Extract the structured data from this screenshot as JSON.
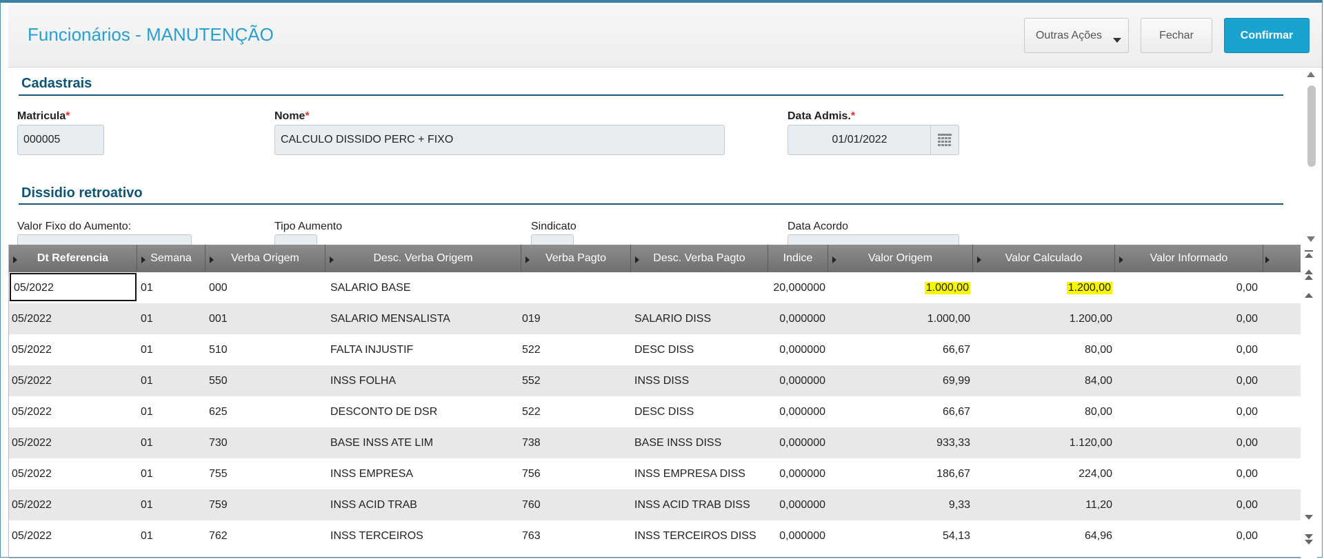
{
  "window": {
    "title": "Funcionários - MANUTENÇÃO"
  },
  "toolbar": {
    "more_actions_label": "Outras Ações",
    "close_label": "Fechar",
    "confirm_label": "Confirmar"
  },
  "sections": {
    "cadastrais": "Cadastrais",
    "dissidio": "Dissidio retroativo"
  },
  "form": {
    "matricula": {
      "label": "Matricula",
      "value": "000005"
    },
    "nome": {
      "label": "Nome",
      "value": "CALCULO DISSIDO PERC + FIXO"
    },
    "data_admis": {
      "label": "Data Admis.",
      "value": "01/01/2022"
    },
    "required_mark": "*",
    "valor_fixo_label": "Valor Fixo do Aumento:",
    "tipo_aumento_label": "Tipo Aumento",
    "sindicato_label": "Sindicato",
    "data_acordo_label": "Data Acordo"
  },
  "grid": {
    "columns": [
      "Dt Referencia",
      "Semana",
      "Verba Origem",
      "Desc. Verba Origem",
      "Verba Pagto",
      "Desc. Verba Pagto",
      "Indice",
      "Valor Origem",
      "Valor Calculado",
      "Valor Informado"
    ],
    "rows": [
      [
        "05/2022",
        "01",
        "000",
        "SALARIO BASE",
        "",
        "",
        "20,000000",
        "1.000,00",
        "1.200,00",
        "0,00"
      ],
      [
        "05/2022",
        "01",
        "001",
        "SALARIO MENSALISTA",
        "019",
        "SALARIO DISS",
        "0,000000",
        "1.000,00",
        "1.200,00",
        "0,00"
      ],
      [
        "05/2022",
        "01",
        "510",
        "FALTA INJUSTIF",
        "522",
        "DESC DISS",
        "0,000000",
        "66,67",
        "80,00",
        "0,00"
      ],
      [
        "05/2022",
        "01",
        "550",
        "INSS FOLHA",
        "552",
        "INSS DISS",
        "0,000000",
        "69,99",
        "84,00",
        "0,00"
      ],
      [
        "05/2022",
        "01",
        "625",
        "DESCONTO DE DSR",
        "522",
        "DESC DISS",
        "0,000000",
        "66,67",
        "80,00",
        "0,00"
      ],
      [
        "05/2022",
        "01",
        "730",
        "BASE INSS ATE LIM",
        "738",
        "BASE INSS DISS",
        "0,000000",
        "933,33",
        "1.120,00",
        "0,00"
      ],
      [
        "05/2022",
        "01",
        "755",
        "INSS EMPRESA",
        "756",
        "INSS EMPRESA DISS",
        "0,000000",
        "186,67",
        "224,00",
        "0,00"
      ],
      [
        "05/2022",
        "01",
        "759",
        "INSS ACID TRAB",
        "760",
        "INSS ACID TRAB DISS",
        "0,000000",
        "9,33",
        "11,20",
        "0,00"
      ],
      [
        "05/2022",
        "01",
        "762",
        "INSS TERCEIROS",
        "763",
        "INSS TERCEIROS DISS",
        "0,000000",
        "54,13",
        "64,96",
        "0,00"
      ]
    ]
  },
  "colors": {
    "accent": "#2a9fd0",
    "section": "#0c5474",
    "highlight": "#f7f700",
    "confirm": "#1aa3cf"
  }
}
